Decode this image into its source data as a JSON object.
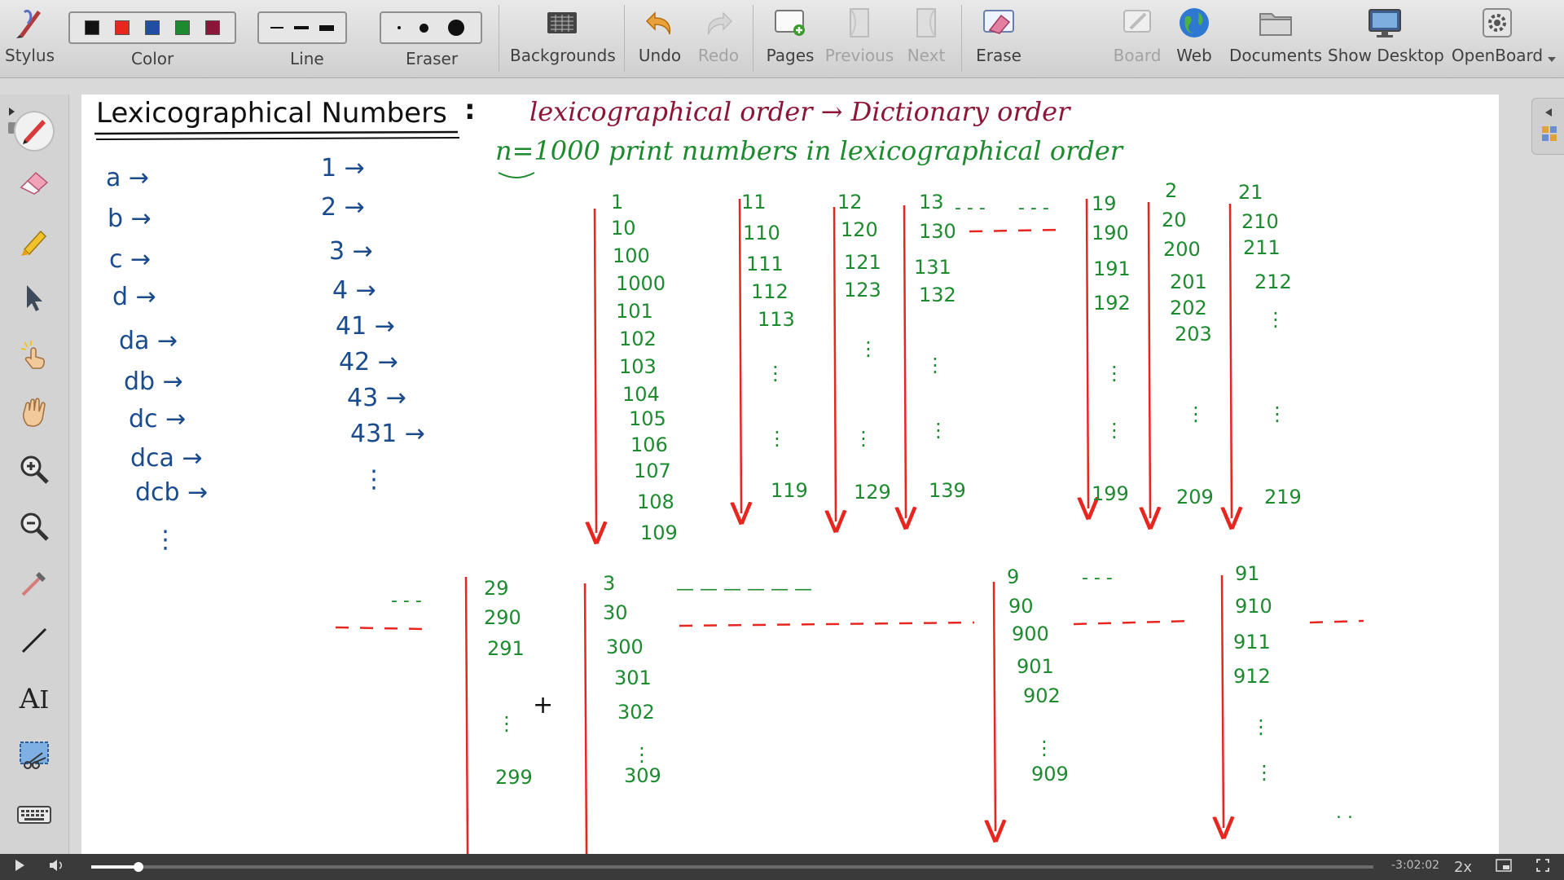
{
  "toolbar": {
    "stylus": "Stylus",
    "color": "Color",
    "line": "Line",
    "eraser": "Eraser",
    "backgrounds": "Backgrounds",
    "undo": "Undo",
    "redo": "Redo",
    "pages": "Pages",
    "previous": "Previous",
    "next": "Next",
    "erase": "Erase",
    "board": "Board",
    "web": "Web",
    "documents": "Documents",
    "show_desktop": "Show Desktop",
    "openboard": "OpenBoard",
    "colors": [
      "#111111",
      "#e8261f",
      "#1f4ea3",
      "#1e8a2f",
      "#8b1637"
    ]
  },
  "dock": {
    "icons": [
      "pen-icon",
      "eraser-icon",
      "highlighter-icon",
      "selector-icon",
      "laser-pointer-icon",
      "hand-icon",
      "zoom-in-icon",
      "zoom-out-icon",
      "pointer-icon",
      "line-icon",
      "text-icon",
      "capture-icon",
      "keyboard-icon"
    ]
  },
  "board": {
    "title": "Lexicographical Numbers",
    "colon": ":",
    "top_line_1": "lexicographical order → Dictionary order",
    "top_line_2": "n=1000   print numbers in lexicographical order",
    "letters": [
      "a →",
      "b →",
      "c →",
      "d →",
      "da →",
      "db →",
      "dc →",
      "dca →",
      "dcb →",
      "⋮"
    ],
    "numbers": [
      "1 →",
      "2 →",
      "3 →",
      "4 →",
      "41 →",
      "42 →",
      "43 →",
      "431 →",
      "⋮"
    ],
    "col1": [
      "1",
      "10",
      "100",
      "1000",
      "101",
      "102",
      "103",
      "104",
      "105",
      "106",
      "107",
      "108",
      "109"
    ],
    "col11": [
      "11",
      "110",
      "111",
      "112",
      "113",
      "⋮",
      "⋮",
      "119"
    ],
    "col12": [
      "12",
      "120",
      "121",
      "123",
      "⋮",
      "⋮",
      "129"
    ],
    "col13": [
      "13",
      "130",
      "131",
      "132",
      "⋮",
      "⋮",
      "139"
    ],
    "col19": [
      "19",
      "190",
      "191",
      "192",
      "⋮",
      "⋮",
      "199"
    ],
    "col2": [
      "2",
      "20",
      "200",
      "201",
      "202",
      "203",
      "⋮",
      "209"
    ],
    "col21": [
      "21",
      "210",
      "211",
      "212",
      "⋮",
      "⋮",
      "219"
    ],
    "col29": [
      "29",
      "290",
      "291",
      "⋮",
      "299"
    ],
    "col3": [
      "3",
      "30",
      "300",
      "301",
      "302",
      "⋮",
      "309"
    ],
    "col9": [
      "9",
      "90",
      "900",
      "901",
      "902",
      "⋮",
      "909"
    ],
    "col91": [
      "91",
      "910",
      "911",
      "912",
      "⋮",
      "⋮"
    ],
    "dashes_short": "- - -",
    "dashes_long": "— — — — — —",
    "plus": "+",
    "dots": ". ."
  },
  "player": {
    "time": "-3:02:02",
    "speed": "2x",
    "progress": 0.037
  },
  "colors": {
    "ink_black": "#111111",
    "ink_blue": "#1a4b8c",
    "ink_maroon": "#8b1637",
    "ink_green": "#1e8a2f",
    "ink_red": "#e8261f"
  }
}
